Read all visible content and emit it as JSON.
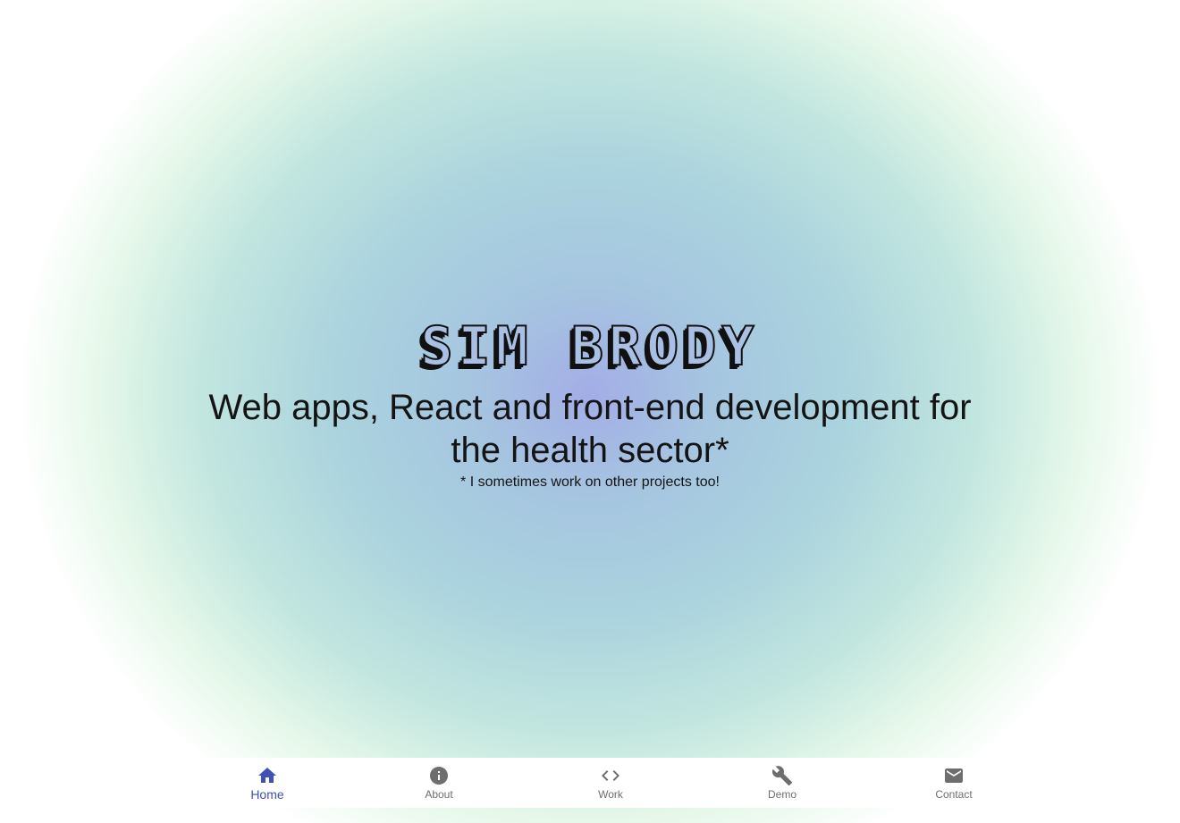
{
  "hero": {
    "name": "SIM BRODY",
    "tagline": "Web apps, React and front-end development for the health sector*",
    "footnote": "* I sometimes work on other projects too!"
  },
  "theme": {
    "accent": "#3f51b5",
    "inactive": "#6e6e6e",
    "gradient_center": "#a3ade6",
    "gradient_mid": "#abd3de",
    "gradient_edge": "#e6f8ea"
  },
  "bottom_nav": {
    "active": "Home",
    "items": [
      {
        "label": "Home",
        "icon": "home-icon"
      },
      {
        "label": "About",
        "icon": "info-icon"
      },
      {
        "label": "Work",
        "icon": "code-icon"
      },
      {
        "label": "Demo",
        "icon": "wrench-icon"
      },
      {
        "label": "Contact",
        "icon": "mail-icon"
      }
    ]
  }
}
